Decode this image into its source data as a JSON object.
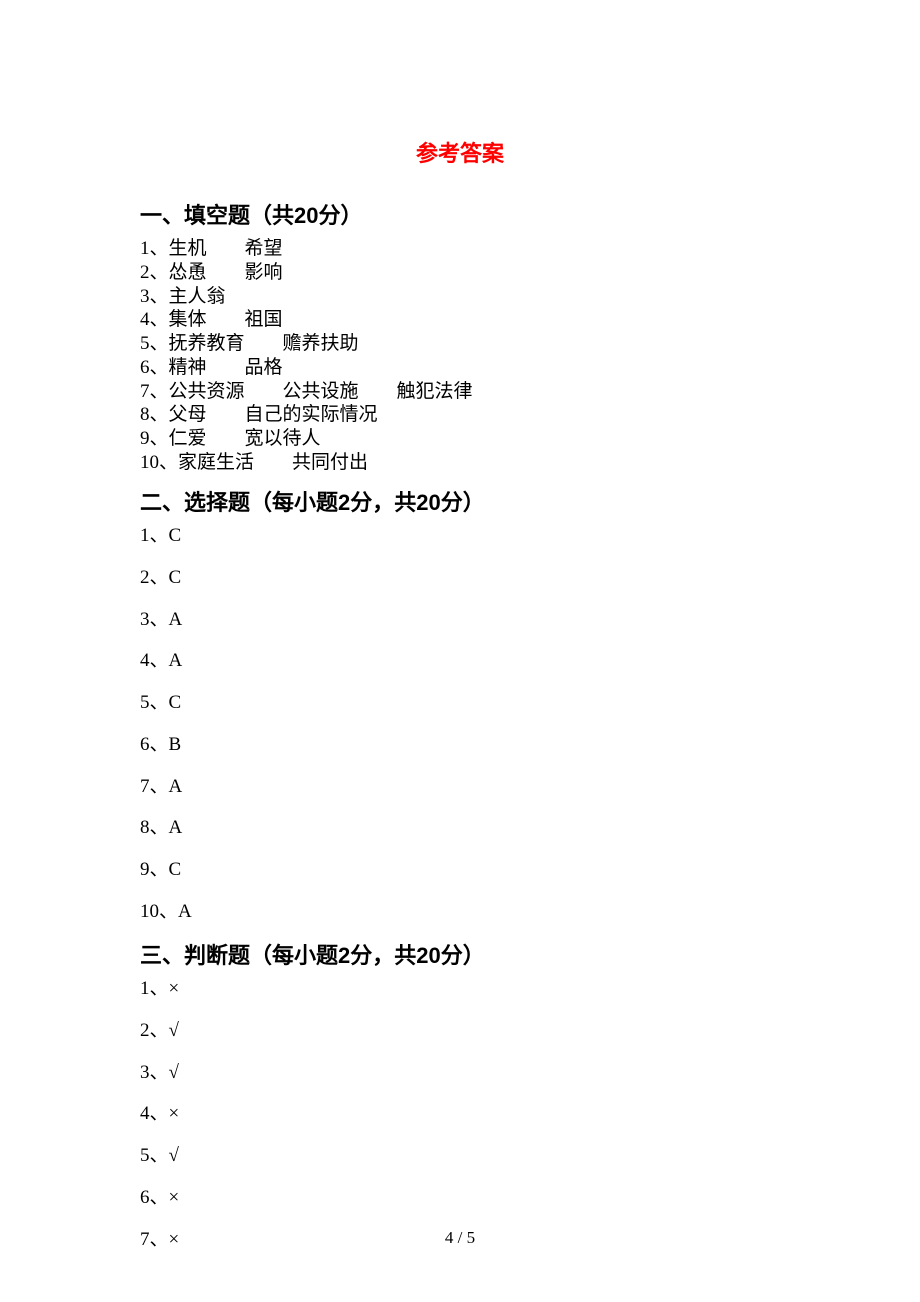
{
  "title": "参考答案",
  "sections": {
    "s1": {
      "heading": "一、填空题（共20分）",
      "items": [
        "1、生机　　希望",
        "2、怂恿　　影响",
        "3、主人翁",
        "4、集体　　祖国",
        "5、抚养教育　　赡养扶助",
        "6、精神　　品格",
        "7、公共资源　　公共设施　　触犯法律",
        "8、父母　　自己的实际情况",
        "9、仁爱　　宽以待人",
        "10、家庭生活　　共同付出"
      ]
    },
    "s2": {
      "heading": "二、选择题（每小题2分，共20分）",
      "items": [
        "1、C",
        "2、C",
        "3、A",
        "4、A",
        "5、C",
        "6、B",
        "7、A",
        "8、A",
        "9、C",
        "10、A"
      ]
    },
    "s3": {
      "heading": "三、判断题（每小题2分，共20分）",
      "items": [
        "1、×",
        "2、√",
        "3、√",
        "4、×",
        "5、√",
        "6、×",
        "7、×"
      ]
    }
  },
  "footer": "4 / 5"
}
